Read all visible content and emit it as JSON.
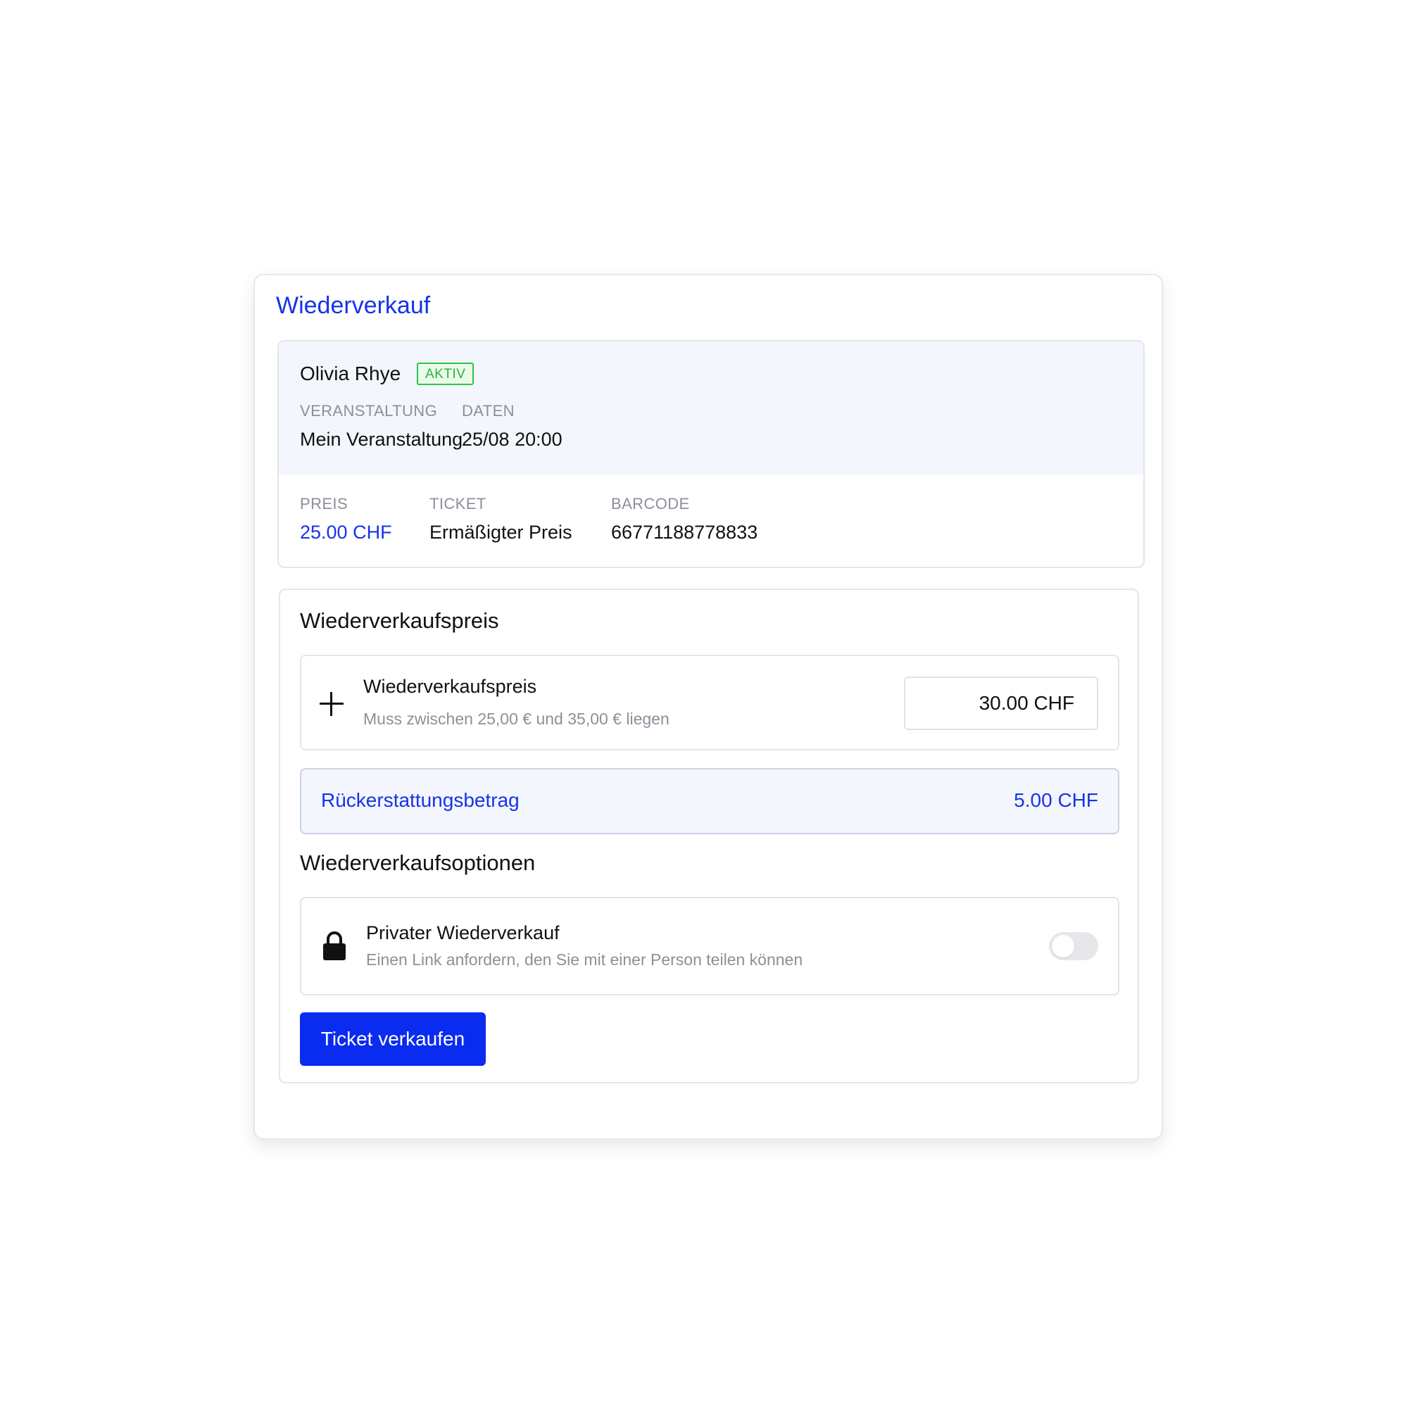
{
  "card": {
    "title": "Wiederverkauf"
  },
  "ticket": {
    "holder_name": "Olivia Rhye",
    "status": "AKTIV",
    "event_label": "VERANSTALTUNG",
    "event_value": "Mein Veranstaltung",
    "date_label": "DATEN",
    "date_value": "25/08 20:00",
    "price_label": "PREIS",
    "price_value": "25.00 CHF",
    "ticket_label": "TICKET",
    "ticket_value": "Ermäßigter Preis",
    "barcode_label": "BARCODE",
    "barcode_value": "66771188778833"
  },
  "resale_price": {
    "heading": "Wiederverkaufspreis",
    "row_title": "Wiederverkaufspreis",
    "row_hint": "Muss zwischen 25,00 € und 35,00 € liegen",
    "input_value": "30.00 CHF",
    "icon": "plus-icon"
  },
  "refund": {
    "label": "Rückerstattungsbetrag",
    "value": "5.00 CHF"
  },
  "options": {
    "heading": "Wiederverkaufsoptionen",
    "private_title": "Privater Wiederverkauf",
    "private_hint": "Einen Link anfordern, den Sie mit einer Person teilen können",
    "private_enabled": false,
    "icon": "lock-icon"
  },
  "actions": {
    "sell_label": "Ticket verkaufen"
  },
  "colors": {
    "accent": "#1733e6",
    "button": "#0a2bf0",
    "status_green": "#26b33f",
    "panel_bg": "#f3f6fd",
    "muted_text": "#8a909b"
  }
}
